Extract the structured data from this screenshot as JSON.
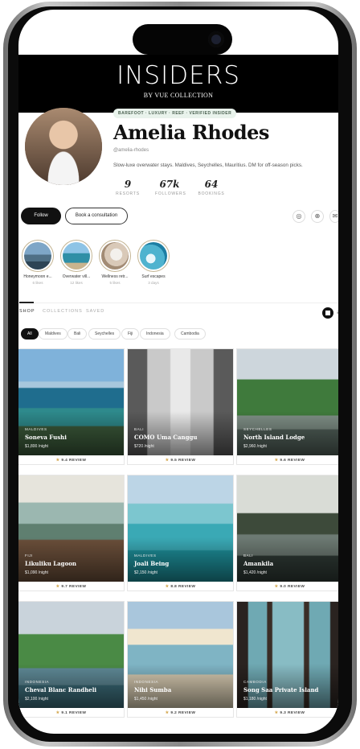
{
  "brand": {
    "title": "INSIDERS",
    "subtitle": "BY VUE COLLECTION"
  },
  "profile": {
    "tagline": "BAREFOOT · LUXURY · REEF · VERIFIED INSIDER",
    "name": "Amelia Rhodes",
    "handle": "@amelia-rhodes",
    "bio": "Slow-luxe overwater stays. Maldives, Seychelles, Mauritius. DM for off-season picks.",
    "stats": [
      {
        "value": "9",
        "label": "RESORTS"
      },
      {
        "value": "67k",
        "label": "FOLLOWERS"
      },
      {
        "value": "64",
        "label": "BOOKINGS"
      }
    ]
  },
  "actions": {
    "follow": "Follow",
    "consult": "Book a consultation",
    "icons": [
      "instagram-icon",
      "globe-icon",
      "mail-icon"
    ]
  },
  "highlights": [
    {
      "label": "Honeymoon e...",
      "count": "6 likes"
    },
    {
      "label": "Overwater vill...",
      "count": "12 likes"
    },
    {
      "label": "Wellness retr...",
      "count": "5 likes"
    },
    {
      "label": "Surf escapes",
      "count": "3 days"
    }
  ],
  "tabs": [
    "SHOP",
    "COLLECTIONS",
    "SAVED"
  ],
  "filters": [
    "All",
    "Maldives",
    "Bali",
    "Seychelles",
    "Fiji",
    "Indonesia",
    "Cambodia"
  ],
  "cards": [
    {
      "location": "MALDIVES",
      "name": "Soneva Fushi",
      "price": "$1,800 /night",
      "review": "9.4 REVIEW"
    },
    {
      "location": "BALI",
      "name": "COMO Uma Canggu",
      "price": "$720 /night",
      "review": "9.5 REVIEW"
    },
    {
      "location": "SEYCHELLES",
      "name": "North Island Lodge",
      "price": "$2,960 /night",
      "review": "9.6 REVIEW"
    },
    {
      "location": "FIJI",
      "name": "Likuliku Lagoon",
      "price": "$1,090 /night",
      "review": "9.7 REVIEW"
    },
    {
      "location": "MALDIVES",
      "name": "Joali Being",
      "price": "$2,150 /night",
      "review": "8.8 REVIEW"
    },
    {
      "location": "BALI",
      "name": "Amankila",
      "price": "$1,420 /night",
      "review": "9.0 REVIEW"
    },
    {
      "location": "INDONESIA",
      "name": "Cheval Blanc Randheli",
      "price": "$2,100 /night",
      "review": "9.1 REVIEW"
    },
    {
      "location": "INDONESIA",
      "name": "Nihi Sumba",
      "price": "$1,450 /night",
      "review": "9.2 REVIEW"
    },
    {
      "location": "CAMBODIA",
      "name": "Song Saa Private Island",
      "price": "$1,180 /night",
      "review": "9.3 REVIEW"
    }
  ]
}
